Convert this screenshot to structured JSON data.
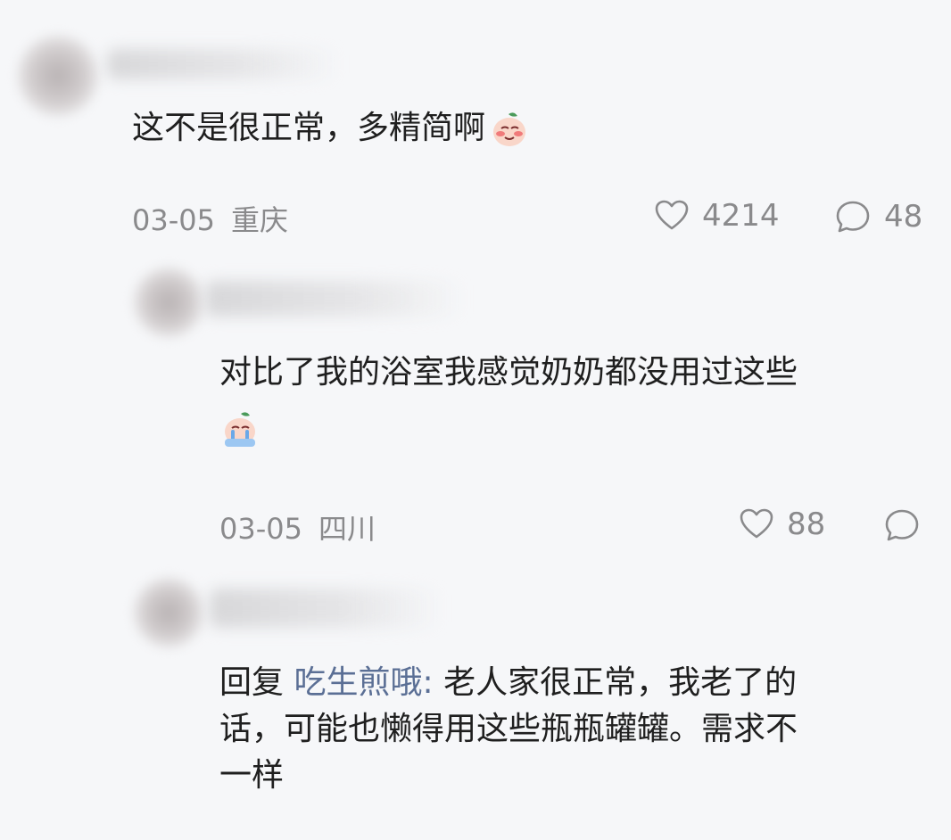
{
  "comments": [
    {
      "text": "这不是很正常，多精简啊",
      "date": "03-05",
      "location": "重庆",
      "likes": "4214",
      "replies": "48",
      "emoji_icon": "blushing-face-icon"
    },
    {
      "text": "对比了我的浴室我感觉奶奶都没用过这些",
      "date": "03-05",
      "location": "四川",
      "likes": "88",
      "emoji_icon": "crying-face-icon"
    },
    {
      "reply_prefix": "回复",
      "reply_to": "吃生煎哦:",
      "lines": [
        "老人家很正常，我老了的",
        "话，可能也懒得用这些瓶瓶罐罐。需求不",
        "一样"
      ]
    }
  ],
  "colors": {
    "background": "#f6f7f9",
    "text": "#1f1f1f",
    "meta": "#8a8a8c",
    "reply_name": "#5b6f95"
  }
}
